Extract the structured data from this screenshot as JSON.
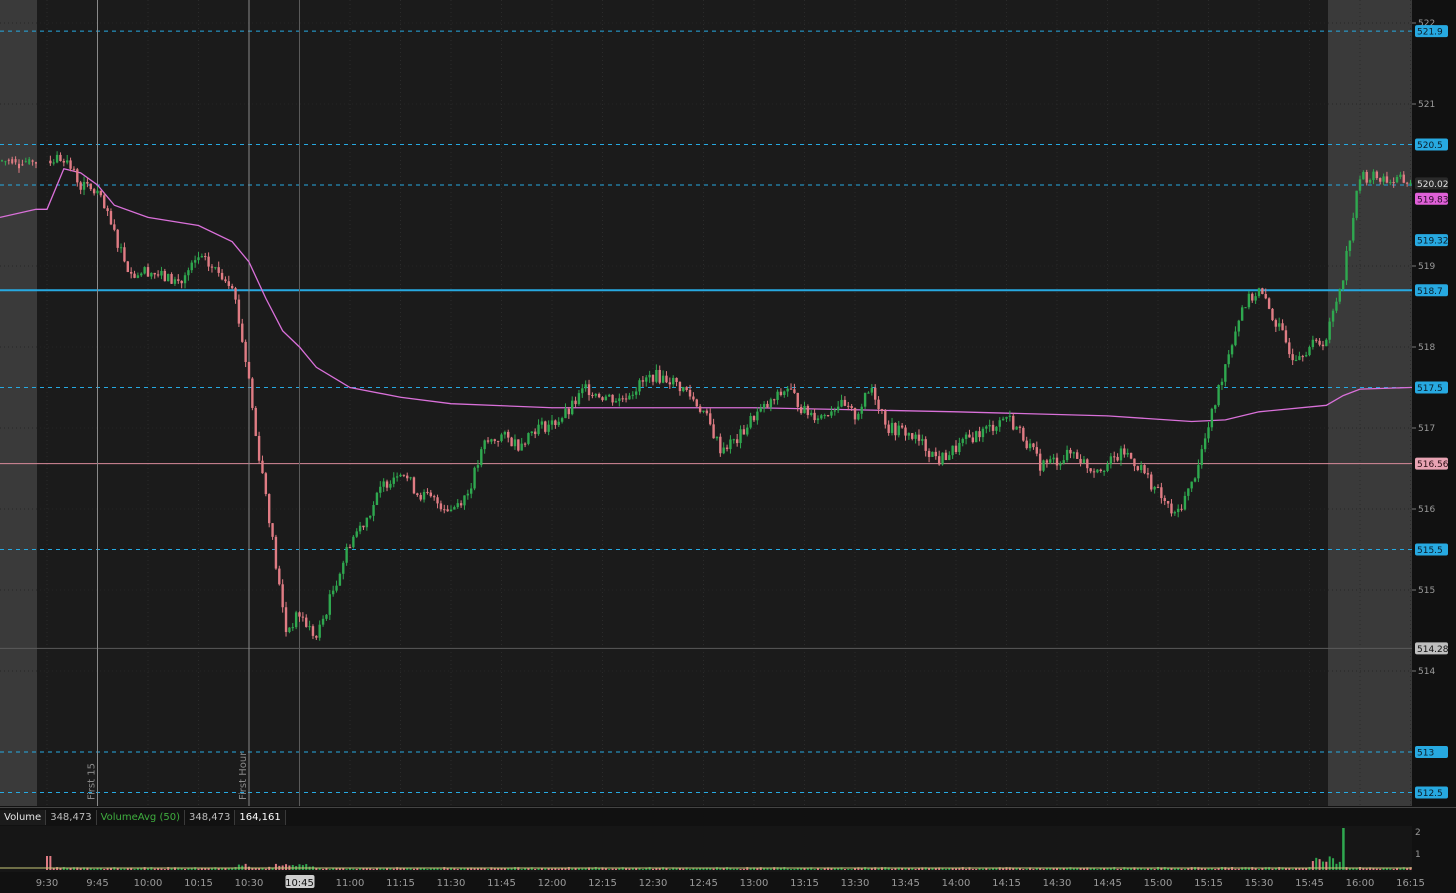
{
  "chart_data": {
    "type": "candlestick",
    "title": "",
    "ylim": [
      512.25,
      522.25
    ],
    "price_ticks": [
      "522",
      "521",
      "519",
      "518",
      "517",
      "516",
      "515",
      "514"
    ],
    "time_ticks": [
      "9:30",
      "9:45",
      "10:00",
      "10:15",
      "10:30",
      "10:45",
      "11:00",
      "11:15",
      "11:30",
      "11:45",
      "12:00",
      "12:15",
      "12:30",
      "12:45",
      "13:00",
      "13:15",
      "13:30",
      "13:45",
      "14:00",
      "14:15",
      "14:30",
      "14:45",
      "15:00",
      "15:15",
      "15:30",
      "15:45",
      "16:00",
      "16:15"
    ],
    "time_range": [
      "9:30",
      "16:15"
    ],
    "highlighted_time": "10:45",
    "extended_hours_shaded": true,
    "horizontal_levels": [
      {
        "value": 521.9,
        "label": "521.9",
        "style": "dashed",
        "color": "#27a9e1"
      },
      {
        "value": 520.5,
        "label": "520.5",
        "style": "dashed",
        "color": "#27a9e1"
      },
      {
        "value": 520.0,
        "label": "",
        "style": "dashed",
        "color": "#27a9e1"
      },
      {
        "value": 518.7,
        "label": "518.7",
        "style": "solid",
        "color": "#27a9e1"
      },
      {
        "value": 517.5,
        "label": "517.5",
        "style": "dashed",
        "color": "#27a9e1"
      },
      {
        "value": 516.56,
        "label": "516.56",
        "style": "solid",
        "color": "#d98a9a"
      },
      {
        "value": 515.5,
        "label": "515.5",
        "style": "dashed",
        "color": "#27a9e1"
      },
      {
        "value": 513.0,
        "label": "513",
        "style": "dashed",
        "color": "#27a9e1"
      },
      {
        "value": 512.5,
        "label": "512.5",
        "style": "dashed",
        "color": "#27a9e1"
      }
    ],
    "price_badges": [
      {
        "value": 520.02,
        "label": "520.02",
        "kind": "last"
      },
      {
        "value": 519.83,
        "label": "519.83",
        "kind": "vwap"
      },
      {
        "value": 519.32,
        "label": "519.32",
        "kind": "level"
      },
      {
        "value": 514.28,
        "label": "514.28",
        "kind": "crosshair"
      }
    ],
    "vertical_markers": [
      {
        "time": "9:45",
        "label": "First 15"
      },
      {
        "time": "10:30",
        "label": "First Hour"
      }
    ],
    "price_path": [
      [
        "9:30",
        520.3
      ],
      [
        "9:35",
        520.35
      ],
      [
        "9:40",
        520.0
      ],
      [
        "9:45",
        519.9
      ],
      [
        "9:50",
        519.4
      ],
      [
        "9:55",
        518.9
      ],
      [
        "10:00",
        518.95
      ],
      [
        "10:05",
        518.85
      ],
      [
        "10:10",
        518.8
      ],
      [
        "10:15",
        519.1
      ],
      [
        "10:20",
        518.95
      ],
      [
        "10:25",
        518.8
      ],
      [
        "10:30",
        517.6
      ],
      [
        "10:32",
        516.9
      ],
      [
        "10:35",
        516.2
      ],
      [
        "10:38",
        515.3
      ],
      [
        "10:41",
        514.5
      ],
      [
        "10:45",
        514.7
      ],
      [
        "10:50",
        514.4
      ],
      [
        "10:55",
        515.0
      ],
      [
        "11:00",
        515.6
      ],
      [
        "11:05",
        515.9
      ],
      [
        "11:10",
        516.3
      ],
      [
        "11:15",
        516.5
      ],
      [
        "11:20",
        516.2
      ],
      [
        "11:25",
        516.1
      ],
      [
        "11:30",
        516.0
      ],
      [
        "11:35",
        516.2
      ],
      [
        "11:40",
        516.8
      ],
      [
        "11:45",
        516.9
      ],
      [
        "11:50",
        516.8
      ],
      [
        "11:55",
        517.0
      ],
      [
        "12:00",
        517.05
      ],
      [
        "12:05",
        517.2
      ],
      [
        "12:10",
        517.5
      ],
      [
        "12:15",
        517.4
      ],
      [
        "12:20",
        517.35
      ],
      [
        "12:25",
        517.5
      ],
      [
        "12:30",
        517.65
      ],
      [
        "12:35",
        517.6
      ],
      [
        "12:40",
        517.45
      ],
      [
        "12:45",
        517.2
      ],
      [
        "12:50",
        516.75
      ],
      [
        "12:55",
        516.85
      ],
      [
        "13:00",
        517.15
      ],
      [
        "13:05",
        517.3
      ],
      [
        "13:10",
        517.5
      ],
      [
        "13:15",
        517.2
      ],
      [
        "13:20",
        517.15
      ],
      [
        "13:25",
        517.3
      ],
      [
        "13:30",
        517.15
      ],
      [
        "13:35",
        517.5
      ],
      [
        "13:40",
        517.0
      ],
      [
        "13:45",
        516.95
      ],
      [
        "13:50",
        516.8
      ],
      [
        "13:55",
        516.6
      ],
      [
        "14:00",
        516.75
      ],
      [
        "14:05",
        516.9
      ],
      [
        "14:10",
        517.0
      ],
      [
        "14:15",
        517.15
      ],
      [
        "14:20",
        516.9
      ],
      [
        "14:25",
        516.55
      ],
      [
        "14:30",
        516.6
      ],
      [
        "14:35",
        516.7
      ],
      [
        "14:40",
        516.5
      ],
      [
        "14:45",
        516.55
      ],
      [
        "14:50",
        516.7
      ],
      [
        "14:55",
        516.5
      ],
      [
        "15:00",
        516.2
      ],
      [
        "15:05",
        515.9
      ],
      [
        "15:10",
        516.3
      ],
      [
        "15:15",
        517.0
      ],
      [
        "15:20",
        517.8
      ],
      [
        "15:25",
        518.5
      ],
      [
        "15:30",
        518.7
      ],
      [
        "15:35",
        518.3
      ],
      [
        "15:40",
        517.9
      ],
      [
        "15:45",
        518.0
      ],
      [
        "15:50",
        518.1
      ],
      [
        "15:55",
        518.9
      ],
      [
        "16:00",
        520.1
      ],
      [
        "16:05",
        520.1
      ],
      [
        "16:10",
        520.05
      ],
      [
        "16:15",
        520.05
      ]
    ],
    "vwap_path": [
      [
        "9:30",
        519.7
      ],
      [
        "9:35",
        520.2
      ],
      [
        "9:40",
        520.15
      ],
      [
        "9:45",
        520.0
      ],
      [
        "9:50",
        519.75
      ],
      [
        "10:00",
        519.6
      ],
      [
        "10:15",
        519.5
      ],
      [
        "10:25",
        519.3
      ],
      [
        "10:30",
        519.05
      ],
      [
        "10:35",
        518.6
      ],
      [
        "10:40",
        518.2
      ],
      [
        "10:45",
        518.0
      ],
      [
        "10:50",
        517.75
      ],
      [
        "11:00",
        517.5
      ],
      [
        "11:15",
        517.38
      ],
      [
        "11:30",
        517.3
      ],
      [
        "12:00",
        517.25
      ],
      [
        "13:00",
        517.25
      ],
      [
        "14:00",
        517.2
      ],
      [
        "14:45",
        517.15
      ],
      [
        "15:10",
        517.08
      ],
      [
        "15:20",
        517.1
      ],
      [
        "15:30",
        517.2
      ],
      [
        "15:50",
        517.28
      ],
      [
        "15:55",
        517.4
      ],
      [
        "16:00",
        517.48
      ],
      [
        "16:15",
        517.5
      ]
    ],
    "volume_indicator": {
      "label": "Volume",
      "value": "348,473",
      "avg_label": "VolumeAvg (50)",
      "avg_value": "348,473",
      "current": "164,161",
      "scale_ticks": [
        "2",
        "1"
      ],
      "spike_time": "15:55"
    }
  }
}
